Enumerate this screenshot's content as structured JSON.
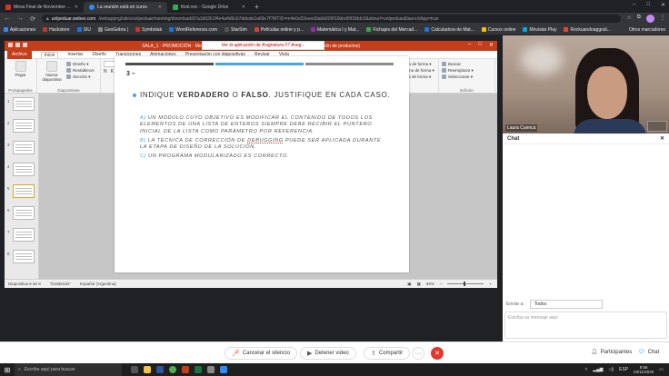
{
  "browser": {
    "tabs": [
      {
        "title": "Mesa Final de Noviembre 2020",
        "color": "#d93025",
        "active": false
      },
      {
        "title": "La reunión está en curso",
        "color": "#2d8cff",
        "active": true
      },
      {
        "title": "final.noc - Google Drive",
        "color": "#34a853",
        "active": false
      }
    ],
    "new_tab": "+",
    "window_controls": [
      "–",
      "□",
      "✕"
    ],
    "url_host": "unlpeduar.webex.com",
    "url_path": "/webappng/sites/unlpeduar/meeting/download/d7a1b52b1f4e4a4d9cb7ddede2a69e7f?MTID=m4e0c82eeed3abb009f16bbd0f03ddc5&siteurl=unlpeduar&launchApp=true",
    "back": "←",
    "forward": "→",
    "reload": "⟳"
  },
  "bookmarks": {
    "items": [
      {
        "label": "Aplicaciones",
        "color": "#4285f4"
      },
      {
        "label": "Hackstore",
        "color": "#c0392b"
      },
      {
        "label": "SIU",
        "color": "#1a73e8"
      },
      {
        "label": "GeoGebra |",
        "color": "#8a8a8a"
      },
      {
        "label": "Symbolab",
        "color": "#d93025"
      },
      {
        "label": "WordReference.com",
        "color": "#1a73e8"
      },
      {
        "label": "StarSim",
        "color": "#555"
      },
      {
        "label": "Películas online y p...",
        "color": "#e53935"
      },
      {
        "label": "Matemática I y Mat...",
        "color": "#9c27b0"
      },
      {
        "label": "Fichajes del Mercad...",
        "color": "#34a853"
      },
      {
        "label": "Calculadora de Mat...",
        "color": "#1a73e8"
      },
      {
        "label": "Cursos online",
        "color": "#fbbc04"
      },
      {
        "label": "Movistar Play",
        "color": "#00a9e0"
      },
      {
        "label": "Rockuandoaggrali...",
        "color": "#ea4335"
      }
    ],
    "other": "Otros marcadores"
  },
  "ppt": {
    "window_title": "SALA_1 · PROMOCIÓN · Modo de compatibilidad · Microsoft PowerPoint (Error de activación de productos)",
    "notification": "Ver la aplicación de Asignatura 07 Aseg...",
    "menu": [
      "Archivo",
      "Inicio",
      "Insertar",
      "Diseño",
      "Transiciones",
      "Animaciones",
      "Presentación con diapositivas",
      "Revisar",
      "Vista"
    ],
    "ribbon": {
      "clipboard": {
        "paste": "Pegar",
        "label": "Portapapeles"
      },
      "slides": {
        "new": "Nueva diapositiva",
        "layout": "Diseño ▾",
        "reset": "Restablecer",
        "section": "Sección ▾",
        "label": "Diapositivas"
      },
      "font": {
        "family": "",
        "size": "",
        "label": "Fuente",
        "styles": [
          "N",
          "K",
          "S",
          "abe",
          "S",
          "AV",
          "Aa",
          "A"
        ]
      },
      "paragraph": {
        "label": "Párrafo",
        "dir": "Dirección del texto ▾",
        "align": "Alinear texto ▾",
        "smartart": "Convertir a SmartArt ▾"
      },
      "drawing": {
        "arrange": "Organizar",
        "styles": "Estilos rápidos",
        "fill": "Relleno de forma ▾",
        "outline": "Contorno de forma ▾",
        "effects": "Efectos de forma ▾",
        "label": "Dibujo"
      },
      "editing": {
        "find": "Buscar",
        "replace": "Reemplazar ▾",
        "select": "Seleccionar ▾",
        "label": "Edición"
      }
    },
    "thumb_numbers": [
      "1",
      "2",
      "3",
      "4",
      "5",
      "6",
      "7",
      "8"
    ],
    "slide": {
      "number": "3 –",
      "question_pre": "INDIQUE ",
      "question_true": "VERDADERO",
      "question_mid": " O ",
      "question_false": "FALSO",
      "question_post": ". JUSTIFIQUE EN CADA CASO.",
      "items": [
        {
          "label": "a)",
          "text": "Un módulo cuyo objetivo es modificar el contenido de todos los elementos de una lista de enteros siempre debe recibir el puntero inicial de la lista como parámetro por referencia."
        },
        {
          "label": "b)",
          "text_pre": "La técnica de corrección de ",
          "text_under": "debugging",
          "text_post": " puede ser aplicada durante la etapa de diseño de la solución."
        },
        {
          "label": "c)",
          "text": "Un programa modularizado es correcto."
        }
      ]
    },
    "status": {
      "slide": "Diapositiva 5 de 8",
      "theme": "\"Dividendo\"",
      "language": "Español (Argentina)",
      "zoom": "65%"
    }
  },
  "participant": {
    "name": "Laura Cuenca"
  },
  "chat": {
    "title": "Chat",
    "close": "✕",
    "send_to_label": "Enviar a:",
    "send_to_value": "Todos",
    "placeholder": "Escriba su mensaje aquí"
  },
  "toolbar": {
    "mute": "Cancelar el silencio",
    "video": "Detener video",
    "share": "Compartir",
    "more": "···",
    "end": "✕",
    "participants": "Participantes",
    "chat": "Chat"
  },
  "taskbar": {
    "search": "Escribe aquí para buscar",
    "time": "8:56",
    "date": "03/11/2020",
    "lang": "ESP"
  },
  "colors": {
    "accent_red": "#c43e1c",
    "slide_blue": "#44a8d9",
    "webex_end": "#e0382d"
  }
}
